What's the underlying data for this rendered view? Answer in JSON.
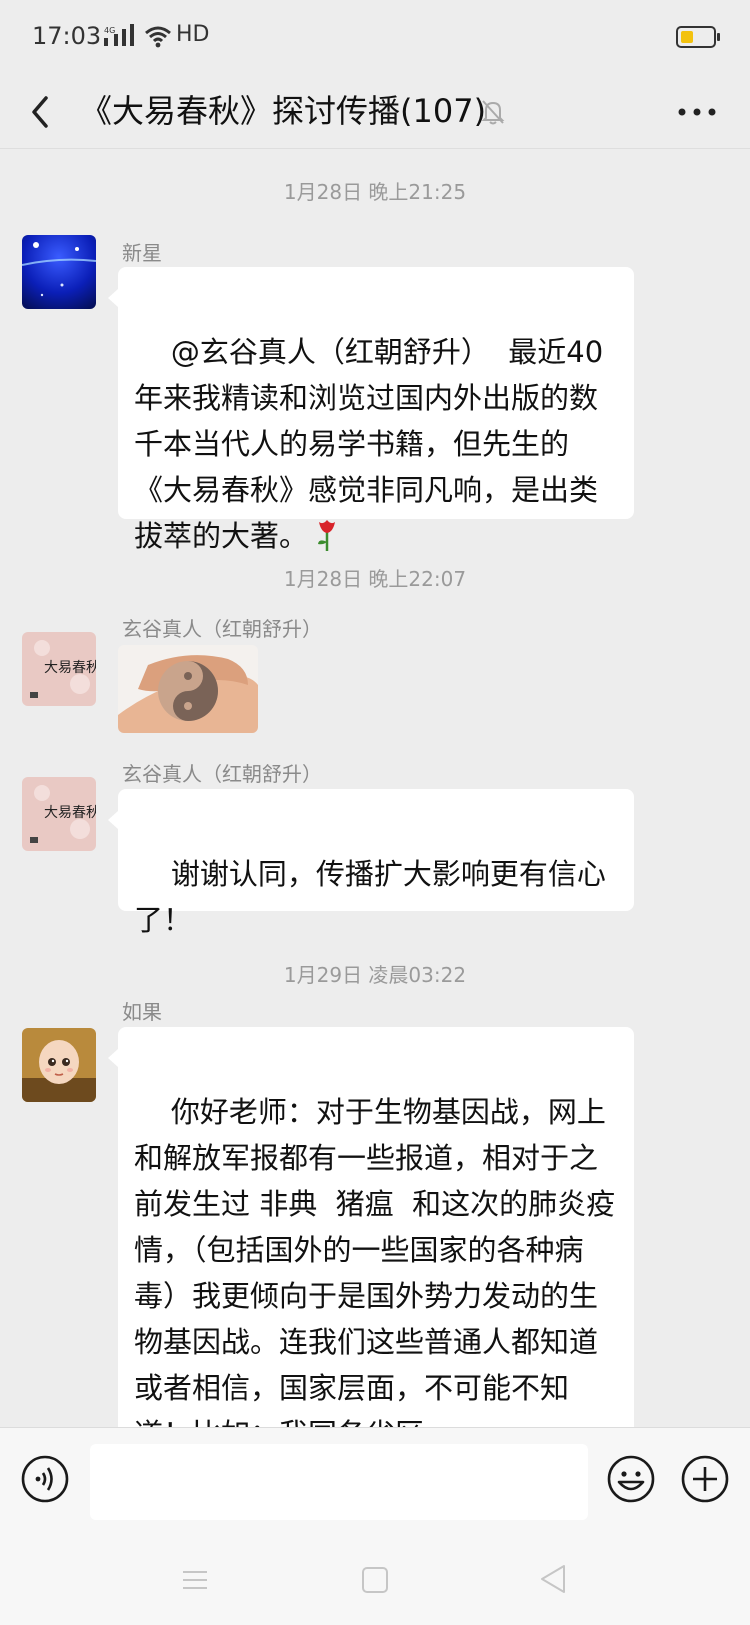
{
  "status_bar": {
    "time": "17:03",
    "network": "4G",
    "hd_label": "HD",
    "battery_color": "#f3c20f"
  },
  "header": {
    "title": "《大易春秋》探讨传播(107)",
    "back_icon": "chevron-left-icon",
    "mute_icon": "bell-off-icon",
    "more_icon": "more-dots-icon"
  },
  "chat": {
    "timestamps": [
      "1月28日 晚上21:25",
      "1月28日 晚上22:07",
      "1月29日 凌晨03:22"
    ],
    "messages": [
      {
        "sender": "新星",
        "avatar": "starry-night-avatar",
        "text": "@玄谷真人（红朝舒升）  最近40年来我精读和浏览过国内外出版的数千本当代人的易学书籍，但先生的《大易春秋》感觉非同凡响，是出类拔萃的大著。",
        "emoji": "rose-icon"
      },
      {
        "sender": "玄谷真人（红朝舒升）",
        "avatar": "book-cover-avatar",
        "sticker": "yin-yang-hands-sticker"
      },
      {
        "sender": "玄谷真人（红朝舒升）",
        "avatar": "book-cover-avatar",
        "text": "谢谢认同，传播扩大影响更有信心了！"
      },
      {
        "sender": "如果",
        "avatar": "cartoon-boy-avatar",
        "text": "你好老师：对于生物基因战，网上和解放军报都有一些报道，相对于之前发生过 非典  猪瘟  和这次的肺炎疫情，（包括国外的一些国家的各种病毒）我更倾向于是国外势力发动的生物基因战。连我们这些普通人都知道或者相信，国家层面，不可能不知道！比如：我国各省区"
      }
    ]
  },
  "input_bar": {
    "voice_icon": "voice-icon",
    "emoji_icon": "smiley-icon",
    "plus_icon": "plus-circle-icon",
    "input_value": ""
  },
  "nav_bar": {
    "menu_icon": "menu-icon",
    "home_icon": "home-square-icon",
    "back_icon": "back-triangle-icon"
  }
}
